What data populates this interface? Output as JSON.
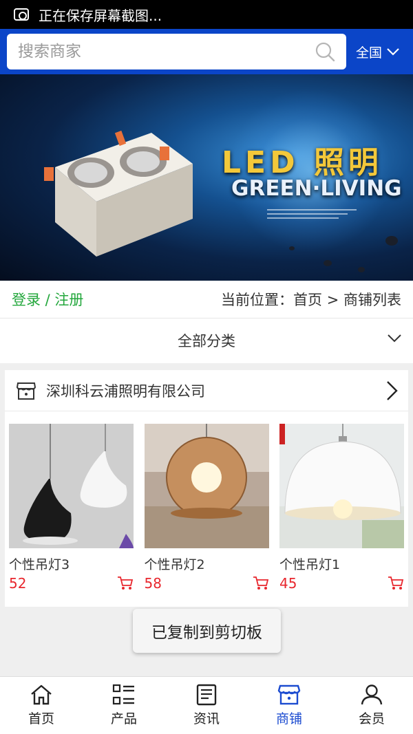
{
  "status_bar": {
    "notice": "正在保存屏幕截图..."
  },
  "search": {
    "placeholder": "搜索商家",
    "region": "全国"
  },
  "banner": {
    "title": "LED 照明",
    "subtitle": "GREEN·LIVING"
  },
  "breadcrumb": {
    "auth": "登录 / 注册",
    "location": "当前位置：首页 > 商铺列表"
  },
  "category": {
    "label": "全部分类"
  },
  "shop": {
    "name": "深圳科云浦照明有限公司",
    "products": [
      {
        "name": "个性吊灯3",
        "price": "52"
      },
      {
        "name": "个性吊灯2",
        "price": "58"
      },
      {
        "name": "个性吊灯1",
        "price": "45"
      }
    ]
  },
  "toast": {
    "message": "已复制到剪切板"
  },
  "tabbar": {
    "items": [
      {
        "label": "首页",
        "icon": "home-icon"
      },
      {
        "label": "产品",
        "icon": "grid-list-icon"
      },
      {
        "label": "资讯",
        "icon": "news-icon"
      },
      {
        "label": "商铺",
        "icon": "store-icon",
        "active": true
      },
      {
        "label": "会员",
        "icon": "user-icon"
      }
    ]
  },
  "colors": {
    "header_blue": "#0b45c8",
    "active_tab": "#1b4bd0",
    "price_red": "#e8262d",
    "login_green": "#23a73c"
  }
}
